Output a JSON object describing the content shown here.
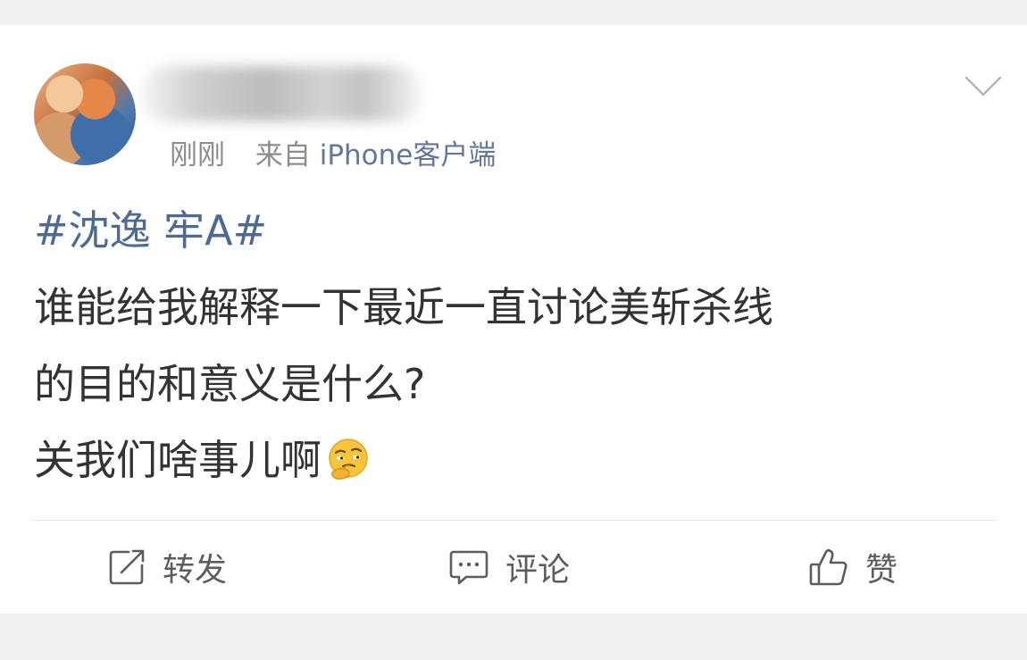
{
  "post": {
    "time": "刚刚",
    "source_prefix": "来自",
    "source": "iPhone客户端",
    "hashtag": "#沈逸 牢A#",
    "content_lines": [
      "谁能给我解释一下最近一直讨论美斩杀线",
      "的目的和意义是什么?",
      "关我们啥事儿啊"
    ],
    "emoji_icon": "thinking-face-emoji"
  },
  "actions": {
    "repost_label": "转发",
    "comment_label": "评论",
    "like_label": "赞"
  },
  "colors": {
    "link": "#4d6a93",
    "text": "#333333",
    "meta": "#8d8d8d",
    "background": "#f1f1f1"
  }
}
